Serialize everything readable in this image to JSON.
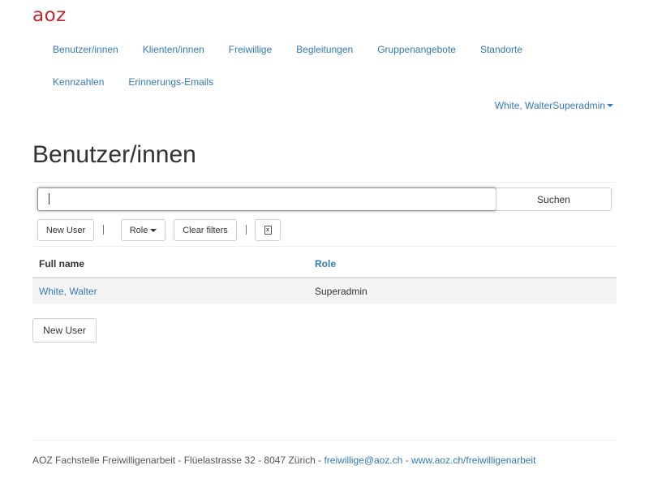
{
  "brand": {
    "logo_text": "aoz"
  },
  "nav": {
    "row1": [
      "Benutzer/innen",
      "Klienten/innen",
      "Freiwillige",
      "Begleitungen",
      "Gruppenangebote",
      "Standorte"
    ],
    "row2": [
      "Kennzahlen",
      "Erinnerungs-Emails"
    ]
  },
  "user_menu": {
    "label": "White, WalterSuperadmin"
  },
  "page": {
    "title": "Benutzer/innen"
  },
  "search": {
    "value": "",
    "button_label": "Suchen"
  },
  "toolbar": {
    "new_user_label": "New User",
    "role_label": "Role",
    "clear_filters_label": "Clear filters",
    "excel_icon": "excel-export-icon"
  },
  "table": {
    "headers": [
      "Full name",
      "Role"
    ],
    "rows": [
      {
        "full_name": "White, Walter",
        "role": "Superadmin"
      }
    ]
  },
  "bottom_new_user_label": "New User",
  "footer": {
    "address": "AOZ Fachstelle Freiwilligenarbeit - Flüelastrasse 32 - 8047 Zürich - ",
    "email": "freiwillige@aoz.ch",
    "separator": " - ",
    "website": "www.aoz.ch/freiwilligenarbeit"
  },
  "colors": {
    "brand": "#c0272d",
    "link": "#337ab7",
    "text": "#333333",
    "row_stripe": "#f5f5f5"
  }
}
